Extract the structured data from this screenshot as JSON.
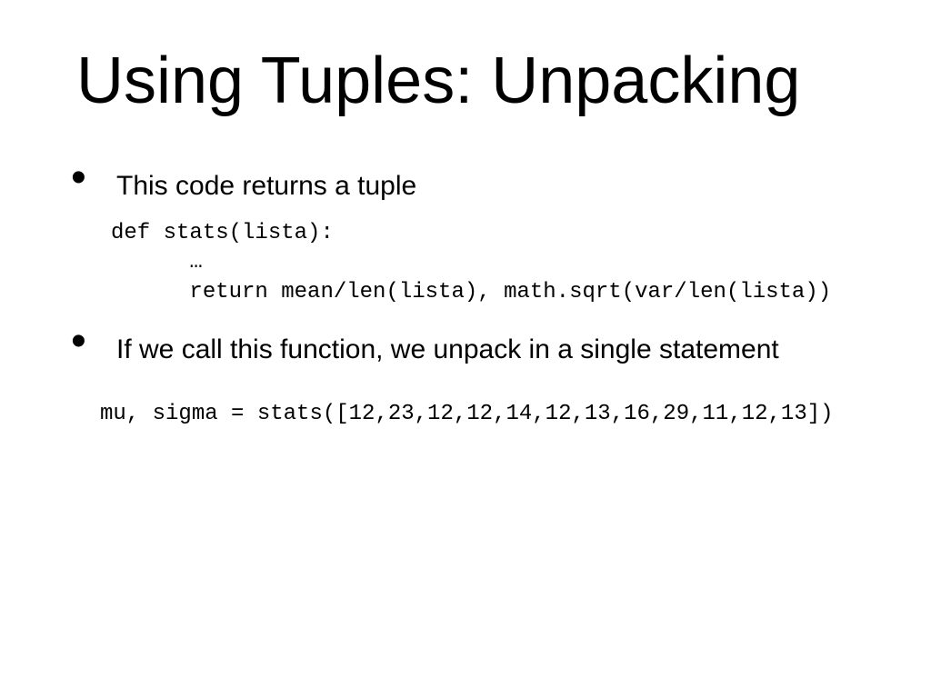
{
  "title": "Using Tuples: Unpacking",
  "bullets": [
    {
      "text": "This code returns a tuple",
      "code": "def stats(lista):\n      …\n      return mean/len(lista), math.sqrt(var/len(lista))"
    },
    {
      "text": "If we call this function, we unpack in a single statement",
      "code": "mu, sigma = stats([12,23,12,12,14,12,13,16,29,11,12,13])"
    }
  ]
}
